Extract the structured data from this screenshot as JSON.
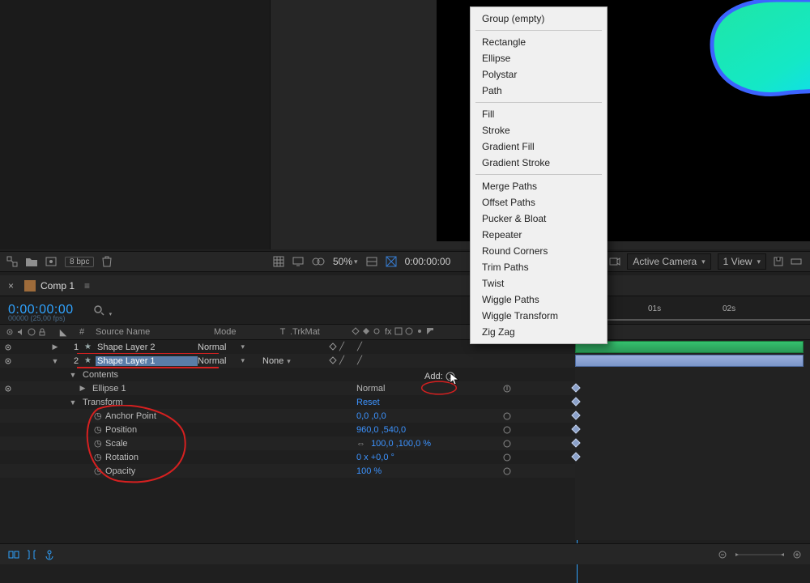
{
  "footer": {
    "bpc": "8 bpc",
    "zoom": "50%",
    "time_display": "0:00:00:00",
    "camera_dd": "Active Camera",
    "view_dd": "1 View"
  },
  "tab": {
    "label": "Comp 1"
  },
  "time_row": {
    "current_time": "0:00:00:00",
    "frames_sub": "00000 (25,00 fps)",
    "tick_01": "01s",
    "tick_02": "02s"
  },
  "col_headers": {
    "num": "#",
    "source": "Source Name",
    "mode": "Mode",
    "t": "T",
    "trkmat": ".TrkMat"
  },
  "layers": [
    {
      "num": "1",
      "name": "Shape Layer 2",
      "mode": "Normal"
    },
    {
      "num": "2",
      "name": "Shape Layer 1",
      "mode": "Normal",
      "trkmat": "None",
      "selected": true
    }
  ],
  "sub": {
    "contents": "Contents",
    "ellipse": "Ellipse 1",
    "ellipse_mode": "Normal",
    "transform": "Transform",
    "transform_reset": "Reset",
    "anchor_point": "Anchor Point",
    "anchor_point_v": "0,0 ,0,0",
    "position": "Position",
    "position_v": "960,0 ,540,0",
    "scale": "Scale",
    "scale_v": "100,0 ,100,0 %",
    "rotation": "Rotation",
    "rotation_v": "0 x +0,0 °",
    "opacity": "Opacity",
    "opacity_v": "100 %"
  },
  "add_label": "Add:",
  "context_menu": {
    "items1": [
      "Group (empty)"
    ],
    "items2": [
      "Rectangle",
      "Ellipse",
      "Polystar",
      "Path"
    ],
    "items3": [
      "Fill",
      "Stroke",
      "Gradient Fill",
      "Gradient Stroke"
    ],
    "items4": [
      "Merge Paths",
      "Offset Paths",
      "Pucker & Bloat",
      "Repeater",
      "Round Corners",
      "Trim Paths",
      "Twist",
      "Wiggle Paths",
      "Wiggle Transform",
      "Zig Zag"
    ]
  }
}
